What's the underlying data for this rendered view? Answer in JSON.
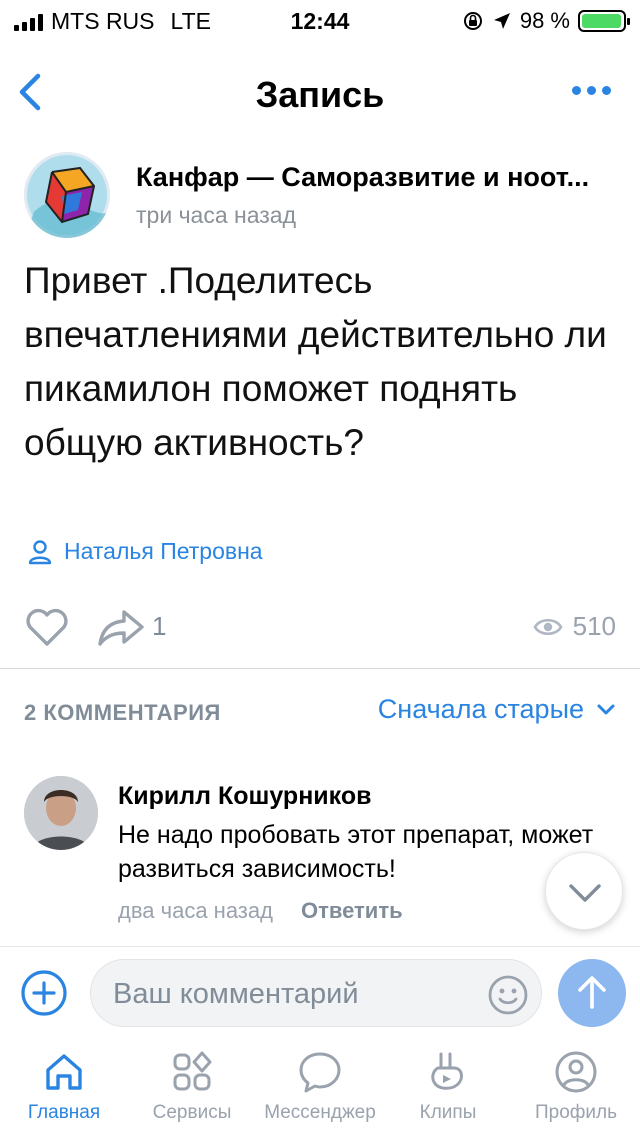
{
  "status_bar": {
    "carrier": "MTS RUS",
    "network": "LTE",
    "time": "12:44",
    "battery": "98 %",
    "battery_level": 0.98
  },
  "nav": {
    "title": "Запись"
  },
  "post": {
    "author": "Канфар — Саморазвитие и ноот...",
    "time": "три часа назад",
    "text": "Привет .Поделитесь впечатлениями действительно ли пикамилон поможет поднять общую активность?",
    "signer": "Наталья Петровна",
    "shares": "1",
    "views": "510"
  },
  "comments_section": {
    "count_label": "2 КОММЕНТАРИЯ",
    "sort_label": "Сначала старые"
  },
  "comments": [
    {
      "author": "Кирилл Кошурников",
      "text": "Не надо пробовать этот препарат, может развиться зависимость!",
      "time": "два часа назад",
      "reply_label": "Ответить"
    }
  ],
  "composer": {
    "placeholder": "Ваш комментарий"
  },
  "tabs": [
    {
      "label": "Главная",
      "icon": "home-icon",
      "active": true
    },
    {
      "label": "Сервисы",
      "icon": "services-icon",
      "active": false
    },
    {
      "label": "Мессенджер",
      "icon": "messenger-icon",
      "active": false
    },
    {
      "label": "Клипы",
      "icon": "clips-icon",
      "active": false
    },
    {
      "label": "Профиль",
      "icon": "profile-icon",
      "active": false
    }
  ],
  "colors": {
    "accent": "#2a84e1",
    "secondary_text": "#818c99",
    "send_button": "#8cb8ef"
  }
}
